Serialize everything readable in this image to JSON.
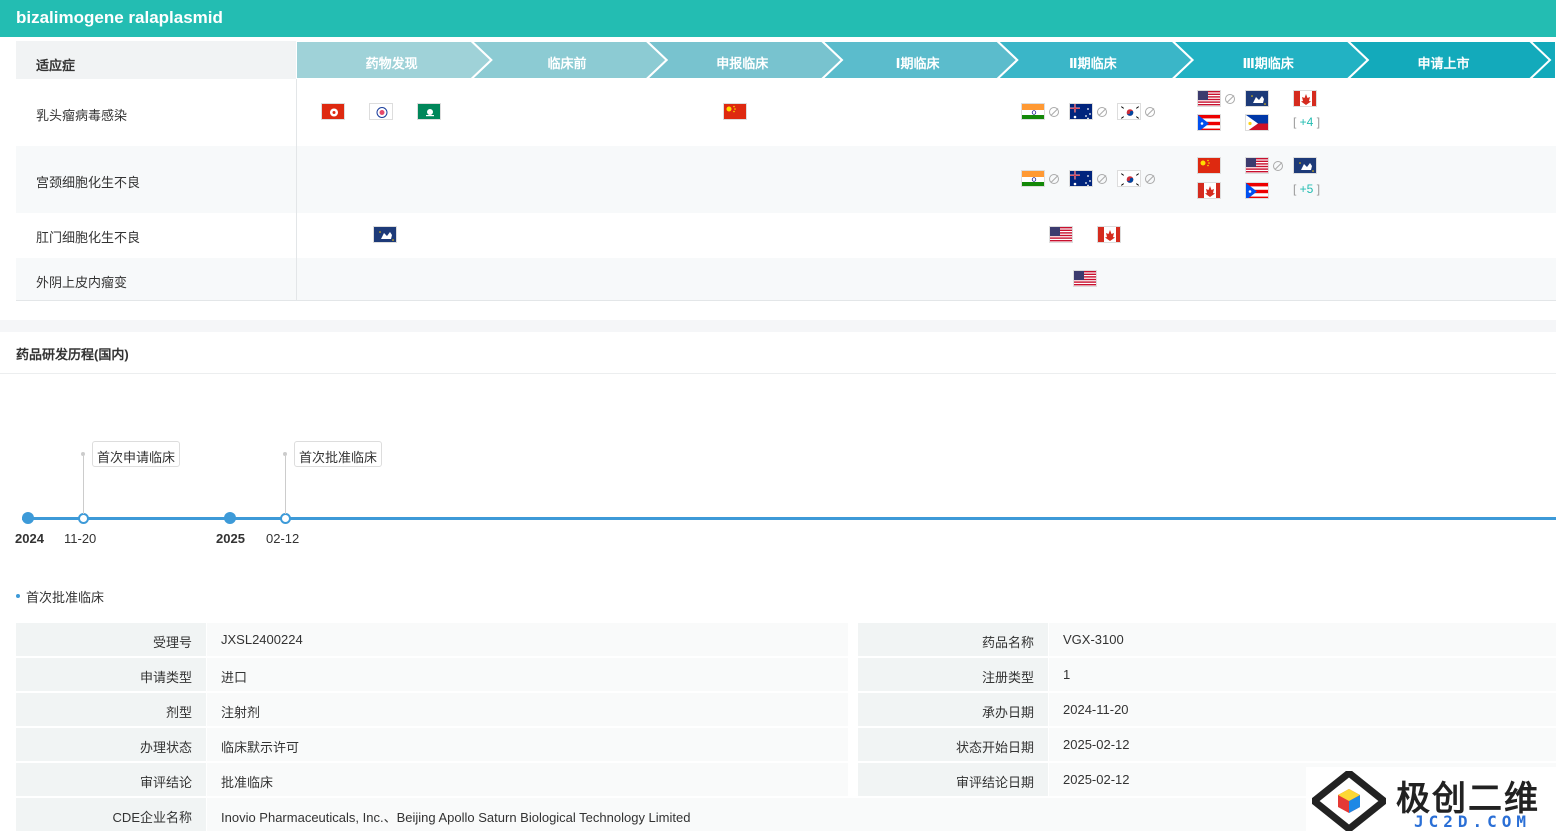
{
  "header": {
    "title": "bizalimogene ralaplasmid"
  },
  "pipeline": {
    "indication_header": "适应症",
    "stages": [
      "药物发现",
      "临床前",
      "申报临床",
      "Ⅰ期临床",
      "Ⅱ期临床",
      "Ⅲ期临床",
      "申请上市"
    ],
    "stage_colors": [
      "#9fd2d8",
      "#8ccbd3",
      "#78c3cf",
      "#5bbccc",
      "#3ab6c8",
      "#22b2c3",
      "#13aabb"
    ],
    "rows": [
      {
        "label": "乳头瘤病毒感染",
        "more": "+4"
      },
      {
        "label": "宫颈细胞化生不良",
        "more": "+5"
      },
      {
        "label": "肛门细胞化生不良"
      },
      {
        "label": "外阴上皮内瘤变"
      }
    ],
    "more_open": "[ ",
    "more_close": " ]"
  },
  "flags": [
    "hongkong",
    "taiwan",
    "macau",
    "china",
    "india",
    "australia",
    "korea",
    "usa",
    "europe",
    "canada",
    "puerto-rico",
    "philippines"
  ],
  "timeline": {
    "title": "药品研发历程(国内)",
    "years": [
      "2024",
      "2025"
    ],
    "dates": [
      "11-20",
      "02-12"
    ],
    "events": [
      "首次申请临床",
      "首次批准临床"
    ]
  },
  "detail": {
    "subtitle": "首次批准临床",
    "left": [
      {
        "k": "受理号",
        "v": "JXSL2400224"
      },
      {
        "k": "申请类型",
        "v": "进口"
      },
      {
        "k": "剂型",
        "v": "注射剂"
      },
      {
        "k": "办理状态",
        "v": "临床默示许可"
      },
      {
        "k": "审评结论",
        "v": "批准临床"
      }
    ],
    "right": [
      {
        "k": "药品名称",
        "v": "VGX-3100"
      },
      {
        "k": "注册类型",
        "v": "1"
      },
      {
        "k": "承办日期",
        "v": "2024-11-20"
      },
      {
        "k": "状态开始日期",
        "v": "2025-02-12"
      },
      {
        "k": "审评结论日期",
        "v": "2025-02-12"
      }
    ],
    "company_label": "CDE企业名称",
    "company": "Inovio Pharmaceuticals, Inc.、Beijing Apollo Saturn Biological Technology Limited"
  },
  "watermark": {
    "main": "极创二维",
    "sub": "JC2D.COM"
  }
}
